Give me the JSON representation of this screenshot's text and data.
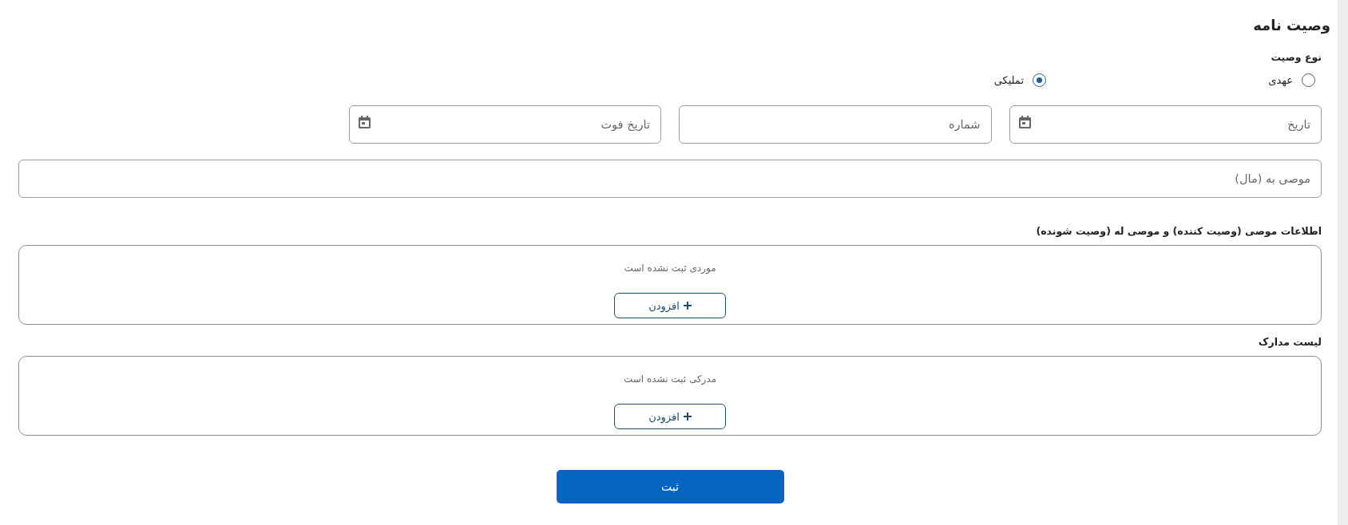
{
  "title": "وصیت نامه",
  "will_type": {
    "label": "نوع وصیت",
    "options": [
      {
        "label": "عهدی",
        "selected": false
      },
      {
        "label": "تملیکی",
        "selected": true
      }
    ]
  },
  "fields": [
    {
      "kind": "date",
      "placeholder": "تاریخ"
    },
    {
      "kind": "text",
      "placeholder": "شماره"
    },
    {
      "kind": "date",
      "placeholder": "تاریخ فوت"
    }
  ],
  "bequest_field": {
    "placeholder": "موصی به (مال)"
  },
  "sections": [
    {
      "heading": "اطلاعات موصی (وصیت کننده) و موصی له (وصیت شونده)",
      "empty_text": "موردی ثبت نشده است",
      "add_button": "افزودن"
    },
    {
      "heading": "لیست مدارک",
      "empty_text": "مدرکی ثبت نشده است",
      "add_button": "افزودن"
    }
  ],
  "submit_button": "ثبت"
}
